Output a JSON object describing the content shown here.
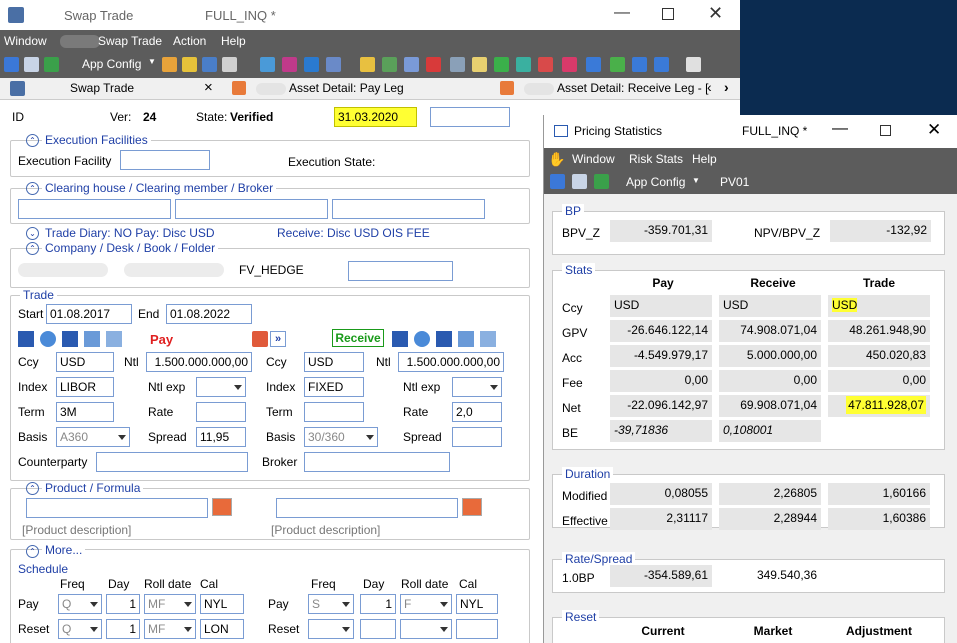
{
  "main": {
    "title_app": "Swap Trade",
    "title_mode": "FULL_INQ *",
    "menu": [
      "Window",
      "Swap Trade",
      "Action",
      "Help"
    ],
    "app_config": "App Config",
    "tabs": [
      {
        "label": "Swap Trade",
        "close": "×"
      },
      {
        "label": "Asset Detail: Pay Leg"
      },
      {
        "label": "Asset Detail: Receive Leg - ["
      }
    ],
    "tab_scroll_left": "‹",
    "tab_scroll_right": "›",
    "id_label": "ID",
    "ver_label": "Ver:",
    "ver_value": "24",
    "state_label": "State:",
    "state_value": "Verified",
    "date_value": "31.03.2020",
    "execution_facilities": "Execution Facilities",
    "execution_facility_label": "Execution Facility",
    "execution_state_label": "Execution State:",
    "clearing_legend": "Clearing house / Clearing member / Broker",
    "trade_diary": "Trade Diary: NO Pay: Disc USD",
    "trade_diary_receive": "Receive: Disc USD OIS FEE",
    "company_legend": "Company / Desk / Book / Folder",
    "folder_value": "FV_HEDGE",
    "trade_legend": "Trade",
    "start_label": "Start",
    "start_value": "01.08.2017",
    "end_label": "End",
    "end_value": "01.08.2022",
    "pay_title": "Pay",
    "receive_title": "Receive",
    "swap_arrow": "»",
    "pay": {
      "ccy": "USD",
      "ntl": "1.500.000.000,00",
      "index": "LIBOR",
      "term": "3M",
      "basis": "A360",
      "spread": "11,95",
      "rate": ""
    },
    "receive": {
      "ccy": "USD",
      "ntl": "1.500.000.000,00",
      "index": "FIXED",
      "term": "",
      "basis": "30/360",
      "rate": "2,0",
      "spread": ""
    },
    "labels": {
      "ccy": "Ccy",
      "ntl": "Ntl",
      "index": "Index",
      "ntl_exp": "Ntl exp",
      "term": "Term",
      "rate": "Rate",
      "basis": "Basis",
      "spread": "Spread",
      "counterparty": "Counterparty",
      "broker": "Broker"
    },
    "product_legend": "Product / Formula",
    "product_desc": "[Product description]",
    "more_label": "More...",
    "schedule_label": "Schedule",
    "sched_headers": [
      "Freq",
      "Day",
      "Roll date",
      "Cal"
    ],
    "sched_rows": {
      "pay": "Pay",
      "reset": "Reset"
    },
    "sched_pay_left": {
      "freq": "Q",
      "day": "1",
      "roll": "MF",
      "cal": "NYL"
    },
    "sched_reset_left": {
      "freq": "Q",
      "day": "1",
      "roll": "MF",
      "cal": "LON"
    },
    "sched_pay_right": {
      "freq": "S",
      "day": "1",
      "roll": "F",
      "cal": "NYL"
    }
  },
  "ps": {
    "title": "Pricing Statistics",
    "mode": "FULL_INQ *",
    "menu": [
      "Window",
      "Risk Stats",
      "Help"
    ],
    "app_config": "App Config",
    "pv01": "PV01",
    "bp_legend": "BP",
    "bpv_label": "BPV_Z",
    "bpv_value": "-359.701,31",
    "npv_label": "NPV/BPV_Z",
    "npv_value": "-132,92",
    "stats_legend": "Stats",
    "cols": [
      "Pay",
      "Receive",
      "Trade"
    ],
    "rows": [
      {
        "label": "Ccy",
        "pay": "USD",
        "receive": "USD",
        "trade": "USD"
      },
      {
        "label": "GPV",
        "pay": "-26.646.122,14",
        "receive": "74.908.071,04",
        "trade": "48.261.948,90"
      },
      {
        "label": "Acc",
        "pay": "-4.549.979,17",
        "receive": "5.000.000,00",
        "trade": "450.020,83"
      },
      {
        "label": "Fee",
        "pay": "0,00",
        "receive": "0,00",
        "trade": "0,00"
      },
      {
        "label": "Net",
        "pay": "-22.096.142,97",
        "receive": "69.908.071,04",
        "trade": "47.811.928,07"
      },
      {
        "label": "BE",
        "pay": "-39,71836",
        "receive": "0,108001",
        "trade": ""
      }
    ],
    "duration_legend": "Duration",
    "modified_label": "Modified",
    "modified": [
      "0,08055",
      "2,26805",
      "1,60166"
    ],
    "effective_label": "Effective",
    "effective": [
      "2,31117",
      "2,28944",
      "1,60386"
    ],
    "rate_legend": "Rate/Spread",
    "bp1_label": "1.0BP",
    "bp1": [
      "-354.589,61",
      "349.540,36"
    ],
    "reset_legend": "Reset",
    "reset_cols": [
      "Current",
      "Market",
      "Adjustment"
    ]
  },
  "colors": {
    "highlight": "#ffff33",
    "accent": "#1f3fa6",
    "pay_red": "#e02020",
    "receive_green": "#1a9a1a",
    "dark_menu": "#5c5c5c"
  }
}
